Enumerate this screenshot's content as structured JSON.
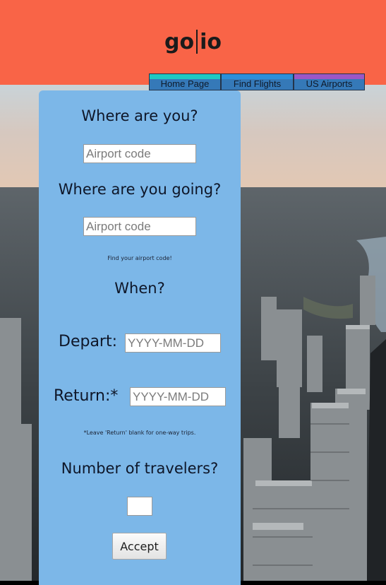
{
  "brand": {
    "logo_left": "go",
    "logo_right": "io"
  },
  "nav": {
    "items": [
      {
        "label": "Home Page",
        "accent": "#1fc9c3"
      },
      {
        "label": "Find Flights",
        "accent": "#2d8fd9"
      },
      {
        "label": "US Airports",
        "accent": "#9b57c7"
      }
    ]
  },
  "form": {
    "origin_question": "Where are you?",
    "origin_placeholder": "Airport code",
    "destination_question": "Where are you going?",
    "destination_placeholder": "Airport code",
    "airport_link": "Find your airport code!",
    "when_heading": "When?",
    "depart_label": "Depart:",
    "depart_placeholder": "YYYY-MM-DD",
    "return_label": "Return:*",
    "return_placeholder": "YYYY-MM-DD",
    "return_note": "*Leave 'Return' blank for one-way trips.",
    "travelers_question": "Number of travelers?",
    "travelers_value": "",
    "accept_label": "Accept"
  },
  "colors": {
    "header": "#f96447",
    "panel": "#7cb7e8",
    "nav_body": "#3579b8"
  }
}
